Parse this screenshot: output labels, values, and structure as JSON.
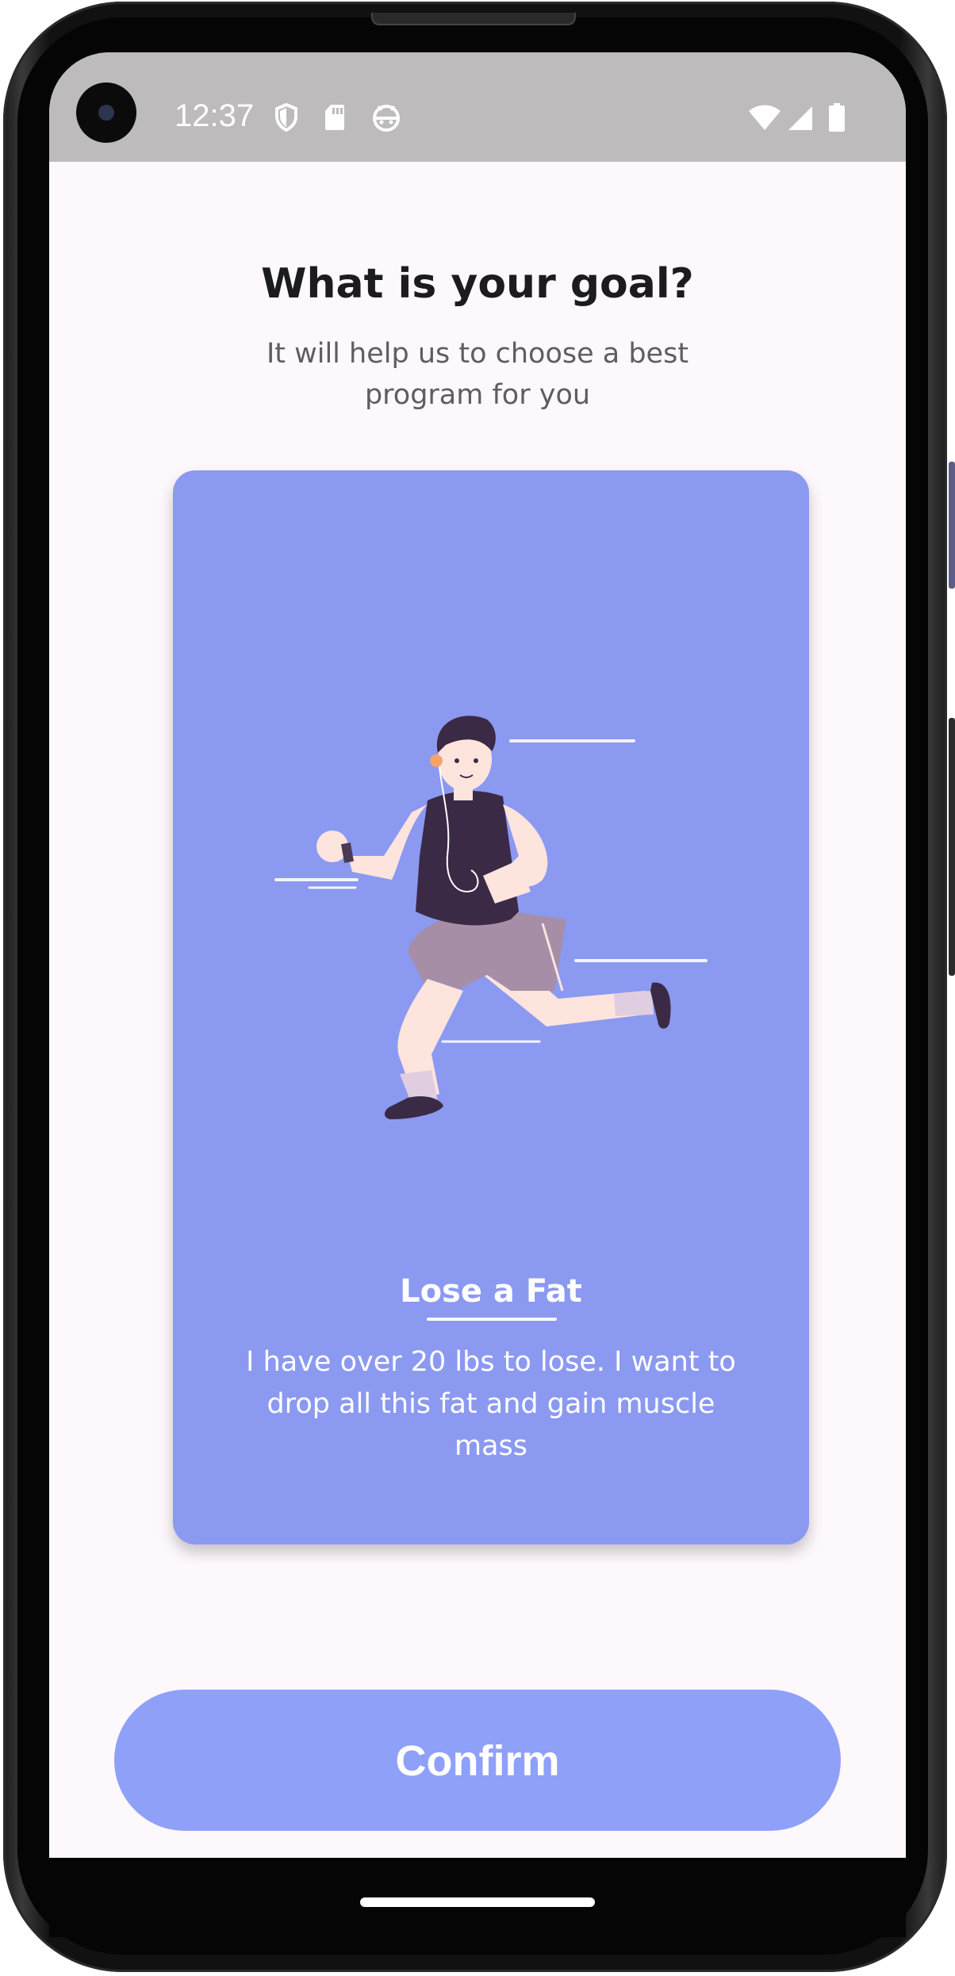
{
  "status_bar": {
    "time": "12:37",
    "icons": [
      "shield-icon",
      "sd-card-icon",
      "android-face-icon",
      "wifi-icon",
      "signal-icon",
      "battery-icon"
    ]
  },
  "screen": {
    "title": "What is your goal?",
    "subtitle": "It will help us to choose a best program for you"
  },
  "goal_card": {
    "illustration": "running-man-illustration",
    "title": "Lose a Fat",
    "description": "I have over 20 lbs to lose. I want to drop all this fat and gain muscle mass",
    "background_color": "#8b99f1"
  },
  "actions": {
    "confirm_label": "Confirm",
    "confirm_color": "#8fa0f9"
  },
  "colors": {
    "screen_background": "#fdf8fc",
    "status_bar": "#bdbbbc",
    "title_text": "#1c1b1e",
    "subtitle_text": "#5f5c62"
  }
}
